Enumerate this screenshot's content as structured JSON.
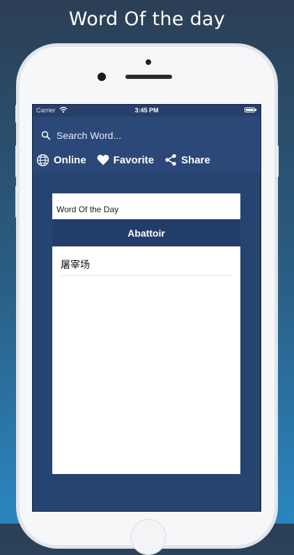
{
  "promo": {
    "title": "Word Of the day"
  },
  "status_bar": {
    "carrier": "Carrier",
    "time": "3:45 PM"
  },
  "search": {
    "placeholder": "Search Word..."
  },
  "actions": [
    {
      "label": "Online",
      "icon": "globe-icon"
    },
    {
      "label": "Favorite",
      "icon": "heart-icon"
    },
    {
      "label": "Share",
      "icon": "share-icon"
    }
  ],
  "card": {
    "header": "Word Of the Day",
    "word": "Abattoir",
    "translation": "屠宰场"
  },
  "colors": {
    "screen_bg": "#25446f",
    "nav_bg": "#2b4878",
    "banner_bg": "#233d6a",
    "accent_text": "#ffffff"
  }
}
